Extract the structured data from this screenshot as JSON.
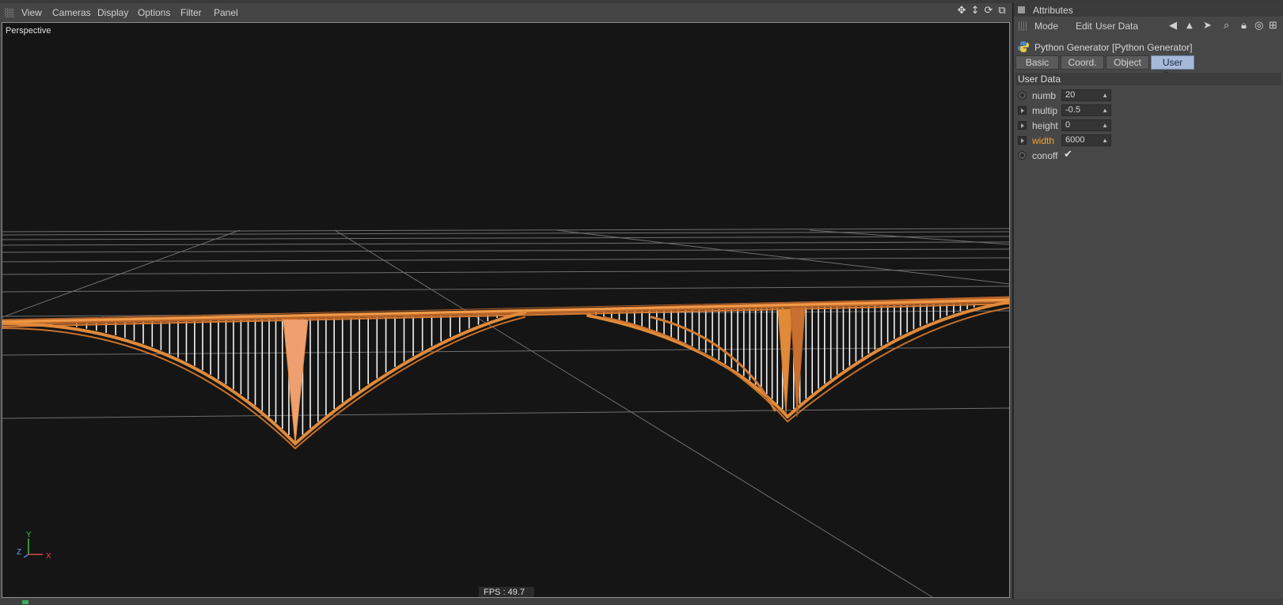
{
  "viewport": {
    "menu": [
      "View",
      "Cameras",
      "Display",
      "Options",
      "Filter",
      "Panel"
    ],
    "icons": [
      "move-icon",
      "dolly-icon",
      "rotate-icon",
      "maximize-icon"
    ],
    "camera_label": "Perspective",
    "fps": "FPS : 49.7",
    "axis": {
      "y": "Y",
      "z": "Z",
      "x": "X"
    },
    "colors": {
      "object": "#e08a3a",
      "lines": "#f2f2f2",
      "grid": "#9a9a9a",
      "background": "#151515"
    }
  },
  "attributes": {
    "title": "Attributes",
    "menu": [
      "Mode",
      "Edit",
      "User Data"
    ],
    "toolbar_icons": [
      "back-arrow-icon",
      "cursor-icon",
      "search-icon",
      "lock-icon",
      "target-icon",
      "new-panel-icon"
    ],
    "object_name": "Python Generator [Python Generator]",
    "tabs": [
      "Basic",
      "Coord.",
      "Object",
      "User Data"
    ],
    "active_tab": "User Data",
    "group": "User Data",
    "params": [
      {
        "label": "numb",
        "value": "20"
      },
      {
        "label": "multip",
        "value": "-0.5"
      },
      {
        "label": "height",
        "value": "0"
      },
      {
        "label": "width",
        "value": "6000"
      },
      {
        "label": "conoff",
        "value": "✔"
      }
    ]
  }
}
